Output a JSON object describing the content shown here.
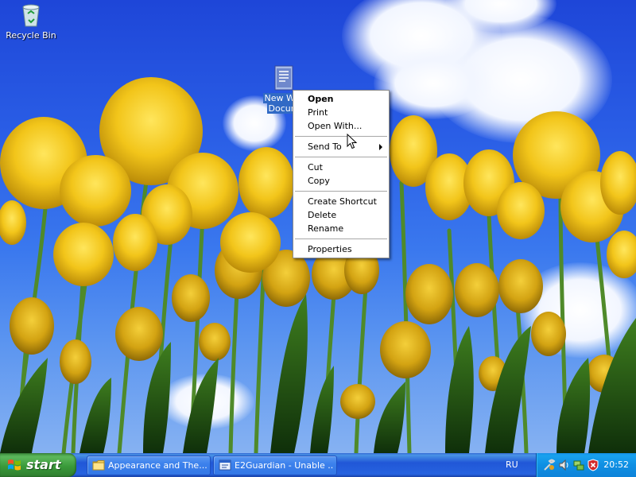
{
  "desktop": {
    "icons": [
      {
        "label": "Recycle Bin",
        "icon": "recycle-bin-icon"
      },
      {
        "label_line1": "New Wor",
        "label_line2": "Docum",
        "icon": "word-document-icon"
      }
    ]
  },
  "context_menu": {
    "items": [
      {
        "label": "Open",
        "default": true
      },
      {
        "label": "Print"
      },
      {
        "label": "Open With..."
      },
      {
        "label": "Send To",
        "submenu": true
      },
      {
        "label": "Cut"
      },
      {
        "label": "Copy"
      },
      {
        "label": "Create Shortcut"
      },
      {
        "label": "Delete"
      },
      {
        "label": "Rename"
      },
      {
        "label": "Properties"
      }
    ]
  },
  "taskbar": {
    "start_label": "start",
    "tasks": [
      {
        "label": "Appearance and The...",
        "icon": "folder-icon"
      },
      {
        "label": "E2Guardian - Unable ...",
        "icon": "browser-icon"
      }
    ],
    "language": "RU",
    "clock": "20:52"
  },
  "colors": {
    "taskbar_blue": "#2157d7",
    "start_green": "#3a9a3a",
    "selection_blue": "#316ac5"
  }
}
